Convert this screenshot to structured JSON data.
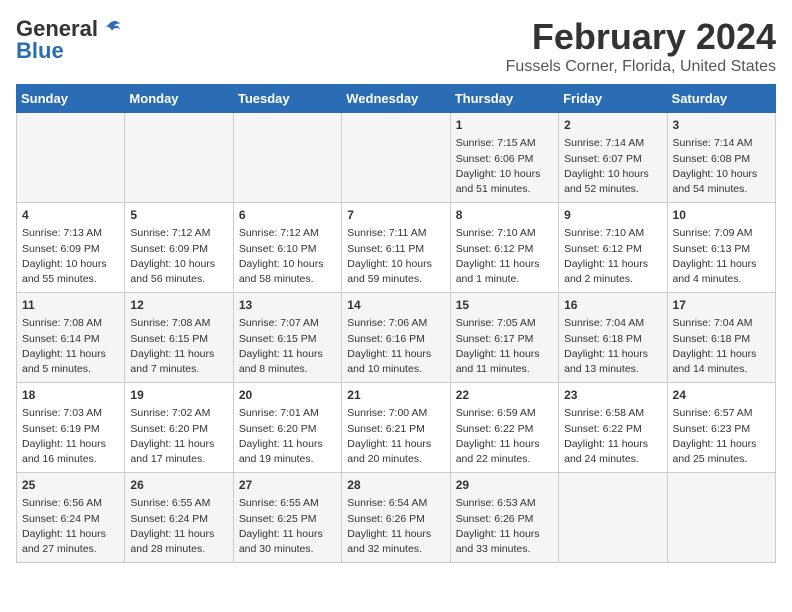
{
  "logo": {
    "text_general": "General",
    "text_blue": "Blue"
  },
  "header": {
    "title": "February 2024",
    "subtitle": "Fussels Corner, Florida, United States"
  },
  "weekdays": [
    "Sunday",
    "Monday",
    "Tuesday",
    "Wednesday",
    "Thursday",
    "Friday",
    "Saturday"
  ],
  "weeks": [
    [
      {
        "day": "",
        "content": ""
      },
      {
        "day": "",
        "content": ""
      },
      {
        "day": "",
        "content": ""
      },
      {
        "day": "",
        "content": ""
      },
      {
        "day": "1",
        "content": "Sunrise: 7:15 AM\nSunset: 6:06 PM\nDaylight: 10 hours\nand 51 minutes."
      },
      {
        "day": "2",
        "content": "Sunrise: 7:14 AM\nSunset: 6:07 PM\nDaylight: 10 hours\nand 52 minutes."
      },
      {
        "day": "3",
        "content": "Sunrise: 7:14 AM\nSunset: 6:08 PM\nDaylight: 10 hours\nand 54 minutes."
      }
    ],
    [
      {
        "day": "4",
        "content": "Sunrise: 7:13 AM\nSunset: 6:09 PM\nDaylight: 10 hours\nand 55 minutes."
      },
      {
        "day": "5",
        "content": "Sunrise: 7:12 AM\nSunset: 6:09 PM\nDaylight: 10 hours\nand 56 minutes."
      },
      {
        "day": "6",
        "content": "Sunrise: 7:12 AM\nSunset: 6:10 PM\nDaylight: 10 hours\nand 58 minutes."
      },
      {
        "day": "7",
        "content": "Sunrise: 7:11 AM\nSunset: 6:11 PM\nDaylight: 10 hours\nand 59 minutes."
      },
      {
        "day": "8",
        "content": "Sunrise: 7:10 AM\nSunset: 6:12 PM\nDaylight: 11 hours\nand 1 minute."
      },
      {
        "day": "9",
        "content": "Sunrise: 7:10 AM\nSunset: 6:12 PM\nDaylight: 11 hours\nand 2 minutes."
      },
      {
        "day": "10",
        "content": "Sunrise: 7:09 AM\nSunset: 6:13 PM\nDaylight: 11 hours\nand 4 minutes."
      }
    ],
    [
      {
        "day": "11",
        "content": "Sunrise: 7:08 AM\nSunset: 6:14 PM\nDaylight: 11 hours\nand 5 minutes."
      },
      {
        "day": "12",
        "content": "Sunrise: 7:08 AM\nSunset: 6:15 PM\nDaylight: 11 hours\nand 7 minutes."
      },
      {
        "day": "13",
        "content": "Sunrise: 7:07 AM\nSunset: 6:15 PM\nDaylight: 11 hours\nand 8 minutes."
      },
      {
        "day": "14",
        "content": "Sunrise: 7:06 AM\nSunset: 6:16 PM\nDaylight: 11 hours\nand 10 minutes."
      },
      {
        "day": "15",
        "content": "Sunrise: 7:05 AM\nSunset: 6:17 PM\nDaylight: 11 hours\nand 11 minutes."
      },
      {
        "day": "16",
        "content": "Sunrise: 7:04 AM\nSunset: 6:18 PM\nDaylight: 11 hours\nand 13 minutes."
      },
      {
        "day": "17",
        "content": "Sunrise: 7:04 AM\nSunset: 6:18 PM\nDaylight: 11 hours\nand 14 minutes."
      }
    ],
    [
      {
        "day": "18",
        "content": "Sunrise: 7:03 AM\nSunset: 6:19 PM\nDaylight: 11 hours\nand 16 minutes."
      },
      {
        "day": "19",
        "content": "Sunrise: 7:02 AM\nSunset: 6:20 PM\nDaylight: 11 hours\nand 17 minutes."
      },
      {
        "day": "20",
        "content": "Sunrise: 7:01 AM\nSunset: 6:20 PM\nDaylight: 11 hours\nand 19 minutes."
      },
      {
        "day": "21",
        "content": "Sunrise: 7:00 AM\nSunset: 6:21 PM\nDaylight: 11 hours\nand 20 minutes."
      },
      {
        "day": "22",
        "content": "Sunrise: 6:59 AM\nSunset: 6:22 PM\nDaylight: 11 hours\nand 22 minutes."
      },
      {
        "day": "23",
        "content": "Sunrise: 6:58 AM\nSunset: 6:22 PM\nDaylight: 11 hours\nand 24 minutes."
      },
      {
        "day": "24",
        "content": "Sunrise: 6:57 AM\nSunset: 6:23 PM\nDaylight: 11 hours\nand 25 minutes."
      }
    ],
    [
      {
        "day": "25",
        "content": "Sunrise: 6:56 AM\nSunset: 6:24 PM\nDaylight: 11 hours\nand 27 minutes."
      },
      {
        "day": "26",
        "content": "Sunrise: 6:55 AM\nSunset: 6:24 PM\nDaylight: 11 hours\nand 28 minutes."
      },
      {
        "day": "27",
        "content": "Sunrise: 6:55 AM\nSunset: 6:25 PM\nDaylight: 11 hours\nand 30 minutes."
      },
      {
        "day": "28",
        "content": "Sunrise: 6:54 AM\nSunset: 6:26 PM\nDaylight: 11 hours\nand 32 minutes."
      },
      {
        "day": "29",
        "content": "Sunrise: 6:53 AM\nSunset: 6:26 PM\nDaylight: 11 hours\nand 33 minutes."
      },
      {
        "day": "",
        "content": ""
      },
      {
        "day": "",
        "content": ""
      }
    ]
  ]
}
